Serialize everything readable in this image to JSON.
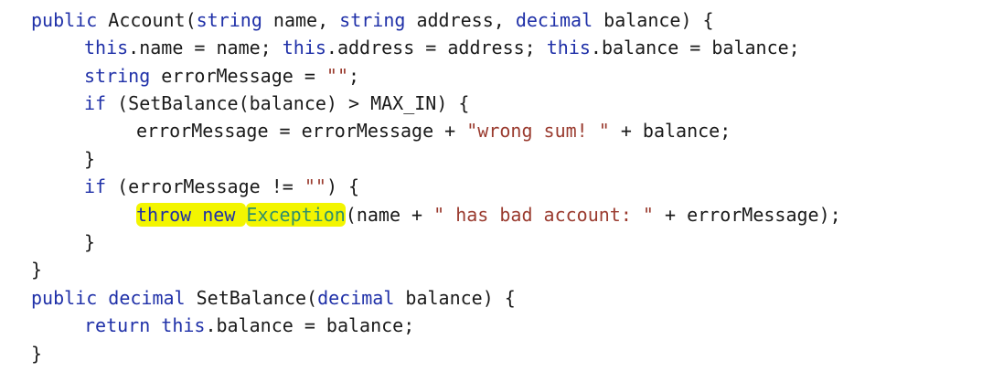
{
  "editor": {
    "lines": [
      [
        {
          "t": "public",
          "c": "kw"
        },
        {
          "t": " Account(",
          "c": "plain"
        },
        {
          "t": "string",
          "c": "kw"
        },
        {
          "t": " name, ",
          "c": "plain"
        },
        {
          "t": "string",
          "c": "kw"
        },
        {
          "t": " address, ",
          "c": "plain"
        },
        {
          "t": "decimal",
          "c": "kw"
        },
        {
          "t": " balance) {",
          "c": "plain"
        }
      ],
      [
        {
          "t": "this",
          "c": "kw"
        },
        {
          "t": ".name = name; ",
          "c": "plain"
        },
        {
          "t": "this",
          "c": "kw"
        },
        {
          "t": ".address = address; ",
          "c": "plain"
        },
        {
          "t": "this",
          "c": "kw"
        },
        {
          "t": ".balance = balance;",
          "c": "plain"
        }
      ],
      [
        {
          "t": "string",
          "c": "kw"
        },
        {
          "t": " errorMessage = ",
          "c": "plain"
        },
        {
          "t": "\"\"",
          "c": "str"
        },
        {
          "t": ";",
          "c": "plain"
        }
      ],
      [
        {
          "t": "if",
          "c": "kw"
        },
        {
          "t": " (SetBalance(balance) > MAX_IN) {",
          "c": "plain"
        }
      ],
      [
        {
          "t": "errorMessage = errorMessage + ",
          "c": "plain"
        },
        {
          "t": "\"wrong sum! \"",
          "c": "str"
        },
        {
          "t": " + balance;",
          "c": "plain"
        }
      ],
      [
        {
          "t": "}",
          "c": "plain"
        }
      ],
      [
        {
          "t": "if",
          "c": "kw"
        },
        {
          "t": " (errorMessage != ",
          "c": "plain"
        },
        {
          "t": "\"\"",
          "c": "str"
        },
        {
          "t": ") {",
          "c": "plain"
        }
      ],
      [
        {
          "t": "throw new ",
          "c": "kw",
          "hl": true
        },
        {
          "t": "Exception",
          "c": "cls",
          "hl": true
        },
        {
          "t": "(name + ",
          "c": "plain"
        },
        {
          "t": "\" has bad account: \"",
          "c": "str"
        },
        {
          "t": " + errorMessage);",
          "c": "plain"
        }
      ],
      [
        {
          "t": "}",
          "c": "plain"
        }
      ],
      [
        {
          "t": "}",
          "c": "plain"
        }
      ],
      [
        {
          "t": "public",
          "c": "kw"
        },
        {
          "t": " ",
          "c": "plain"
        },
        {
          "t": "decimal",
          "c": "kw"
        },
        {
          "t": " SetBalance(",
          "c": "plain"
        },
        {
          "t": "decimal",
          "c": "kw"
        },
        {
          "t": " balance) {",
          "c": "plain"
        }
      ],
      [
        {
          "t": "return",
          "c": "kw"
        },
        {
          "t": " ",
          "c": "plain"
        },
        {
          "t": "this",
          "c": "kw"
        },
        {
          "t": ".balance = balance;",
          "c": "plain"
        }
      ],
      [
        {
          "t": "}",
          "c": "plain"
        }
      ]
    ],
    "colors": {
      "keyword": "#1f30a8",
      "string": "#9a3b2f",
      "class_name": "#2f8f6b",
      "text": "#1a1a1a",
      "highlight": "#f3f500"
    }
  }
}
